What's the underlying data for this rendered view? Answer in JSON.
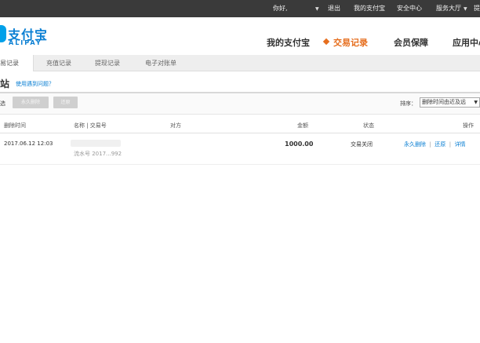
{
  "topbar": {
    "greeting": "你好,",
    "logout": "退出",
    "my_alipay": "我的支付宝",
    "security": "安全中心",
    "service": "服务大厅",
    "extra": "提"
  },
  "logo": {
    "cn": "支付宝",
    "en": "ALIPAY"
  },
  "main_nav": [
    "我的支付宝",
    "交易记录",
    "会员保障",
    "应用中心"
  ],
  "sub_tabs": [
    "交易记录",
    "充值记录",
    "提现记录",
    "电子对账单"
  ],
  "page": {
    "title": "收站",
    "help": "使用遇到问题？"
  },
  "toolbar": {
    "select_all": "全选",
    "delete_forever": "永久删除",
    "restore": "还原",
    "sort_label": "排序：",
    "sort_value": "删除时间由近及远"
  },
  "table": {
    "headers": [
      "删除时间",
      "名称 | 交易号",
      "对方",
      "金额",
      "状态",
      "操作"
    ],
    "rows": [
      {
        "time": "2017.06.12 12:03",
        "serial": "流水号 2017...992",
        "amount": "1000.00",
        "status": "交易关闭",
        "actions": [
          "永久删除",
          "还原",
          "详情"
        ]
      }
    ]
  },
  "colors": {
    "accent": "#e66e1e",
    "link": "#0a7fd3",
    "topbar": "#3a3a3a"
  }
}
